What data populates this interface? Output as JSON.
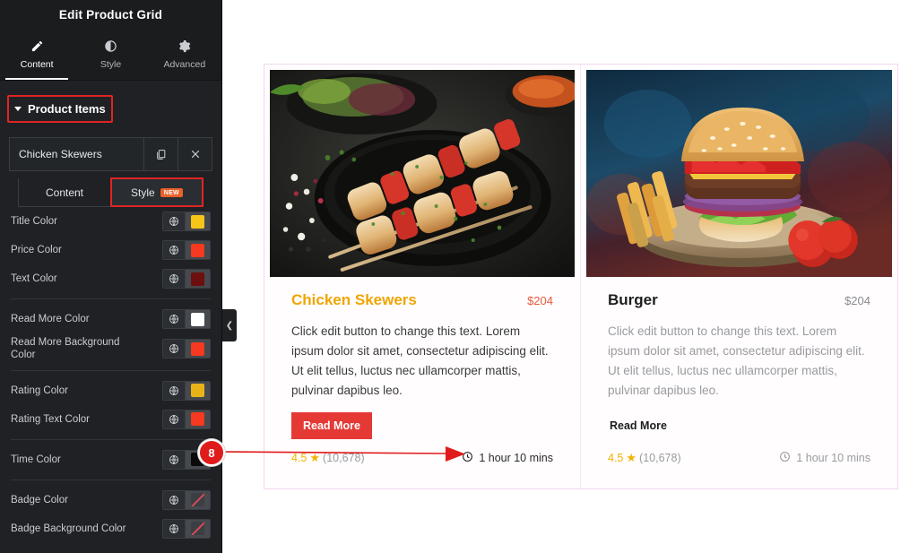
{
  "panel": {
    "title": "Edit Product Grid",
    "tabs": [
      {
        "label": "Content",
        "icon": "pencil-icon",
        "active": true
      },
      {
        "label": "Style",
        "icon": "contrast-icon",
        "active": false
      },
      {
        "label": "Advanced",
        "icon": "gear-icon",
        "active": false
      }
    ],
    "section": {
      "label": "Product Items",
      "caret": "chevron-down-icon"
    },
    "repeater_item": {
      "title": "Chicken Skewers",
      "duplicate_icon": "duplicate-icon",
      "remove_icon": "close-icon"
    },
    "subtabs": {
      "content_label": "Content",
      "style_label": "Style",
      "new_badge": "NEW"
    },
    "controls": [
      {
        "label": "Title Color",
        "swatch": "#f5c518",
        "transparent": false
      },
      {
        "label": "Price Color",
        "swatch": "#f6391f",
        "transparent": false
      },
      {
        "label": "Text Color",
        "swatch": "#6e0f0f",
        "transparent": false
      },
      {
        "label": "Read More Color",
        "swatch": "#ffffff",
        "transparent": false
      },
      {
        "label": "Read More Background Color",
        "swatch": "#f6391f",
        "transparent": false
      },
      {
        "label": "Rating Color",
        "swatch": "#e8b317",
        "transparent": false
      },
      {
        "label": "Rating Text Color",
        "swatch": "#f6391f",
        "transparent": false
      },
      {
        "label": "Time Color",
        "swatch": "#0a0a0a",
        "transparent": false
      },
      {
        "label": "Badge Color",
        "swatch": "",
        "transparent": true
      },
      {
        "label": "Badge Background Color",
        "swatch": "",
        "transparent": true
      }
    ],
    "collapse_handle_icon": "chevron-left-icon"
  },
  "canvas": {
    "cards": [
      {
        "image_alt": "chicken-skewers-photo",
        "title": "Chicken Skewers",
        "price": "$204",
        "description": "Click edit button to change this text. Lorem ipsum dolor sit amet, consectetur adipiscing elit. Ut elit tellus, luctus nec ullamcorper mattis, pulvinar dapibus leo.",
        "read_more": "Read More",
        "rating_value": "4.5",
        "rating_star": "★",
        "rating_count": "(10,678)",
        "time_icon": "clock-icon",
        "time_text": "1 hour 10 mins"
      },
      {
        "image_alt": "burger-photo",
        "title": "Burger",
        "price": "$204",
        "description": "Click edit button to change this text. Lorem ipsum dolor sit amet, consectetur adipiscing elit. Ut elit tellus, luctus nec ullamcorper mattis, pulvinar dapibus leo.",
        "read_more": "Read More",
        "rating_value": "4.5",
        "rating_star": "★",
        "rating_count": "(10,678)",
        "time_icon": "clock-icon",
        "time_text": "1 hour 10 mins"
      }
    ]
  },
  "annotation": {
    "step_number": "8",
    "color": "#e01b1b"
  }
}
